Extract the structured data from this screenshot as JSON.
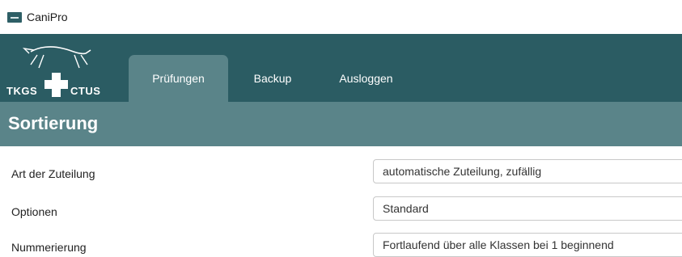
{
  "window": {
    "title": "CaniPro",
    "icon": "canipro-app-icon"
  },
  "header": {
    "logo": {
      "text_left": "TKGS",
      "text_right": "CTUS",
      "icon": "dog-cross-logo"
    },
    "tabs": [
      {
        "label": "Prüfungen",
        "active": true
      },
      {
        "label": "Backup",
        "active": false
      },
      {
        "label": "Ausloggen",
        "active": false
      }
    ]
  },
  "section": {
    "title": "Sortierung"
  },
  "form": {
    "rows": [
      {
        "label": "Art der Zuteilung",
        "value": "automatische Zuteilung, zufällig"
      },
      {
        "label": "Optionen",
        "value": "Standard"
      },
      {
        "label": "Nummerierung",
        "value": "Fortlaufend über alle Klassen bei 1 beginnend"
      }
    ]
  },
  "colors": {
    "header_bg": "#2b5c63",
    "accent_bg": "#5a8489",
    "text_on_dark": "#ffffff"
  }
}
